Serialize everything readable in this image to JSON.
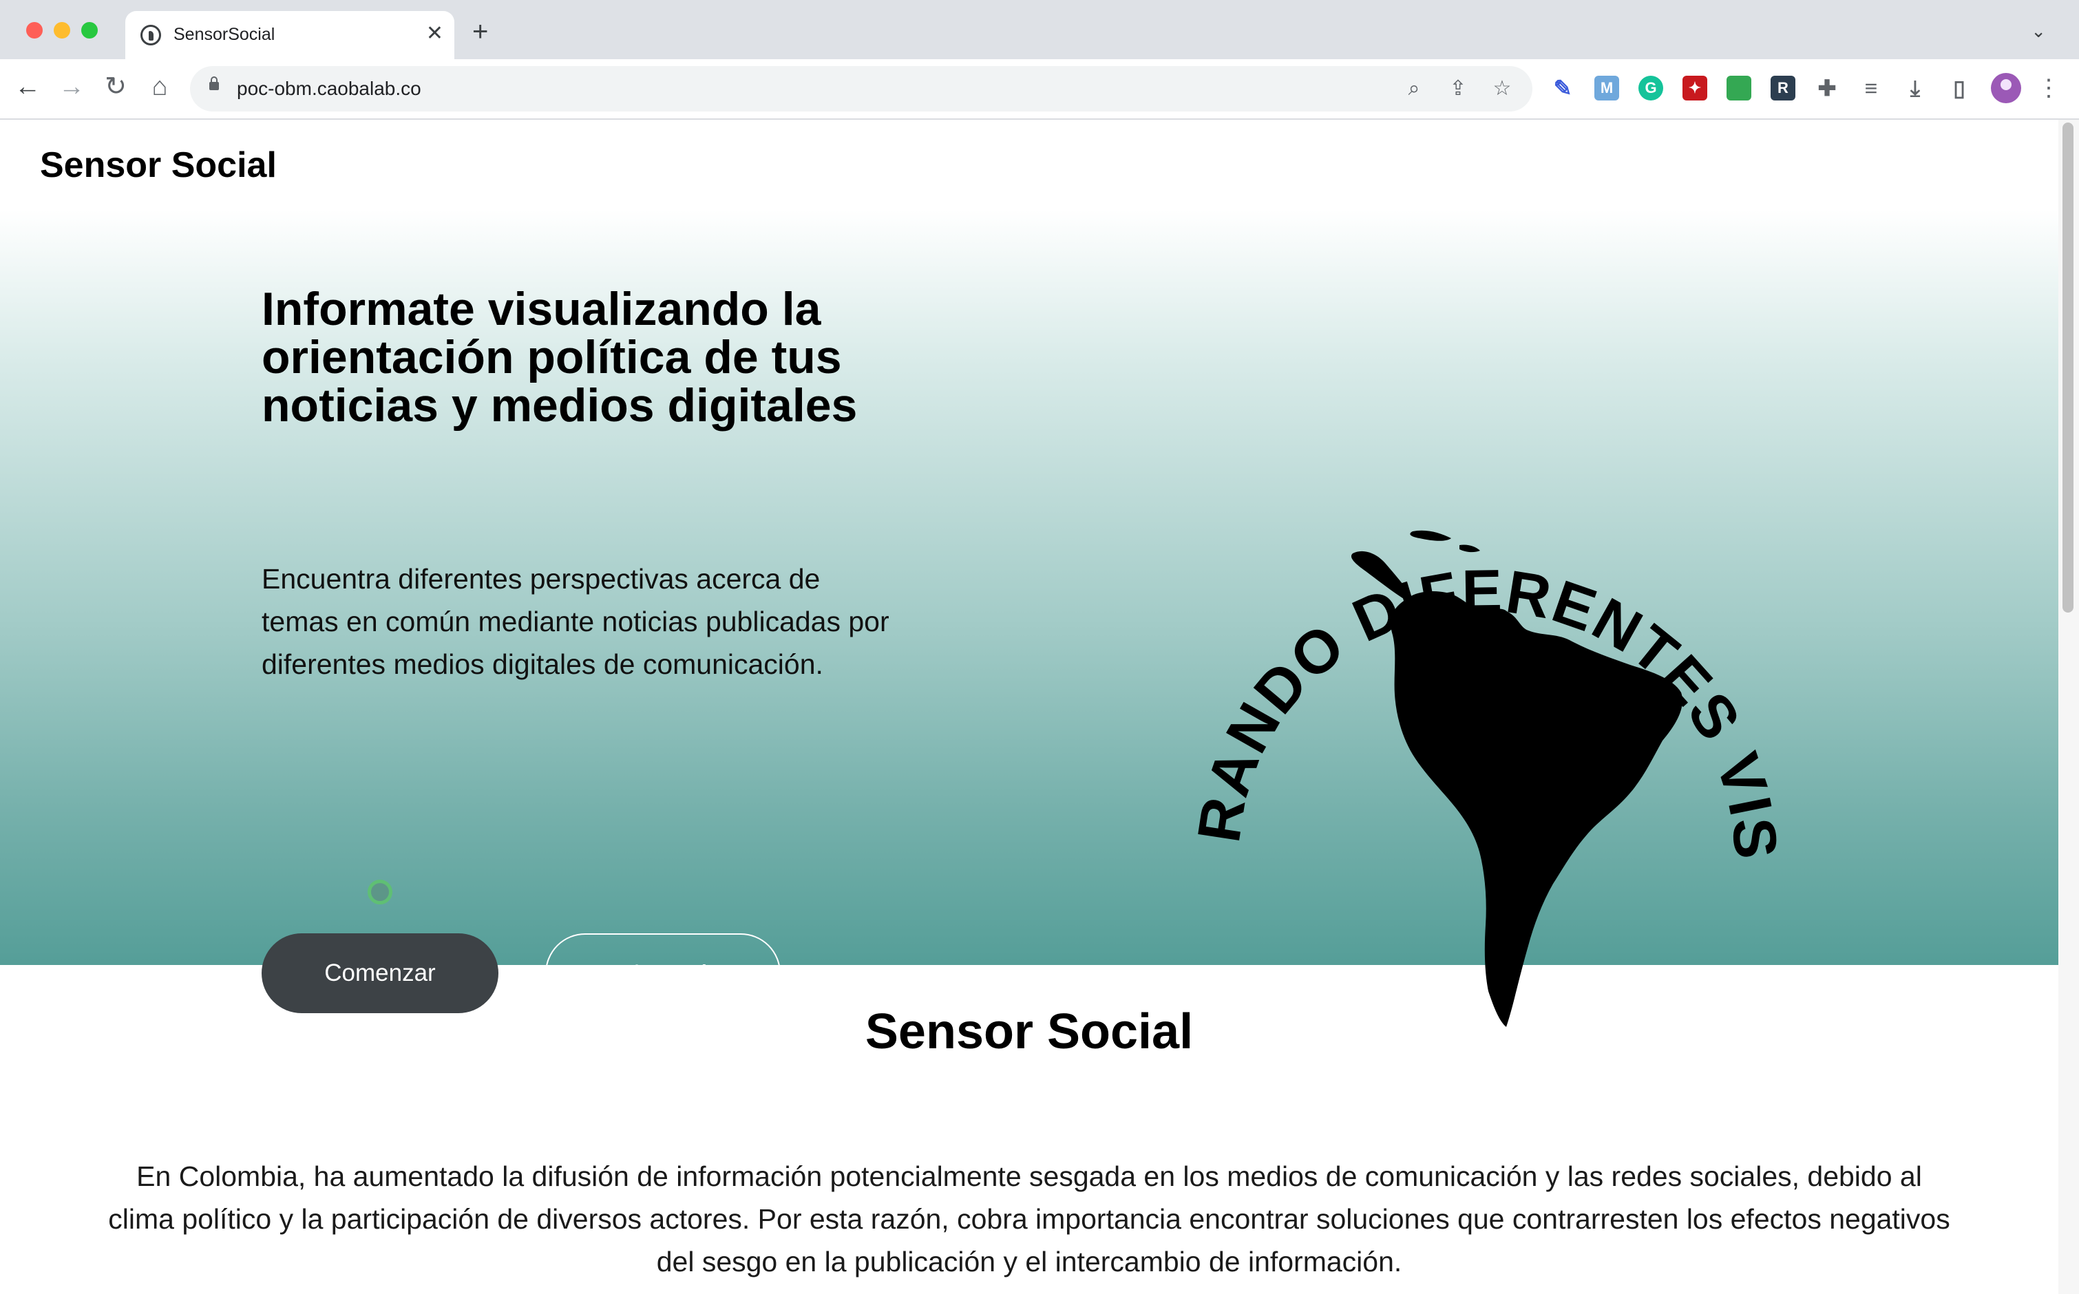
{
  "browser": {
    "tab_title": "SensorSocial",
    "tab_close": "✕",
    "new_tab": "+",
    "tab_menu": "⌄",
    "url": "poc-obm.caobalab.co",
    "extensions": [
      "pen-icon",
      "m-icon",
      "grammarly-icon",
      "pdf-icon",
      "folder-icon",
      "r-icon",
      "puzzle-icon",
      "playlist-icon",
      "download-icon",
      "sidepanel-icon"
    ],
    "ext_letters": {
      "m": "M",
      "grammarly": "G",
      "r": "R"
    }
  },
  "site": {
    "brand": "Sensor Social"
  },
  "hero": {
    "title": "Informate visualizando la orientación política de tus noticias y medios digitales",
    "description": "Encuentra diferentes perspectivas acerca de temas en común mediante noticias publicadas por diferentes medios digitales de comunicación.",
    "primary_button": "Comenzar",
    "secondary_button": "Saber más",
    "logo_text": "EXPLORANDO DIFERENTES VISIONES"
  },
  "section": {
    "title": "Sensor Social",
    "body": "En Colombia, ha aumentado la difusión de información potencialmente sesgada en los medios de comunicación y las redes sociales, debido al clima político y la participación de diversos actores. Por esta razón, cobra importancia encontrar soluciones que contrarresten los efectos negativos del sesgo en la publicación y el intercambio de información."
  },
  "colors": {
    "hero_bottom": "#559e98",
    "primary_button": "#3d4246",
    "chrome": "#dee1e6"
  }
}
